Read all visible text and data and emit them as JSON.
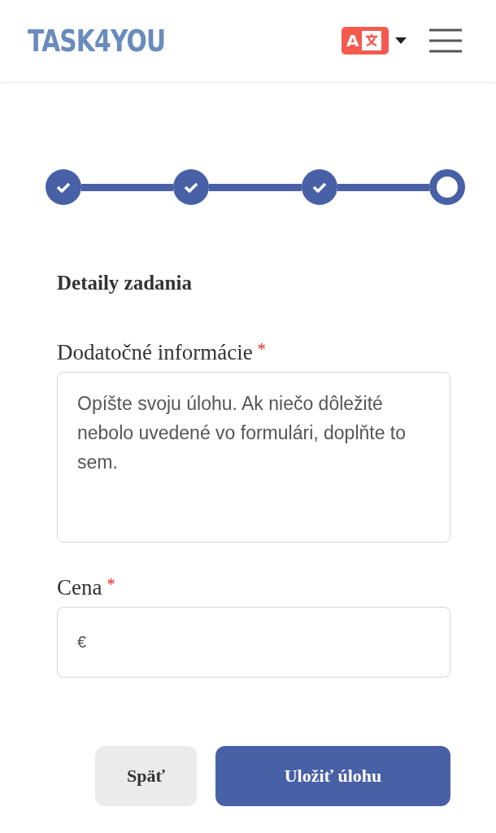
{
  "header": {
    "logo": "TASK4YOU",
    "language_icon": {
      "letter": "A"
    }
  },
  "steps": [
    {
      "completed": true
    },
    {
      "completed": true
    },
    {
      "completed": true
    },
    {
      "completed": false
    }
  ],
  "section_title": "Detaily zadania",
  "fields": [
    {
      "kind": "textarea",
      "label": "Dodatočné informácie",
      "required_mark": "*",
      "placeholder": "Opíšte svoju úlohu. Ak niečo dôležité nebolo uvedené vo formulári, doplňte to sem."
    },
    {
      "kind": "input",
      "label": "Cena",
      "required_mark": "*",
      "placeholder": "€"
    }
  ],
  "buttons": [
    {
      "kind": "secondary",
      "label": "Späť"
    },
    {
      "kind": "primary",
      "label": "Uložiť úlohu"
    }
  ]
}
